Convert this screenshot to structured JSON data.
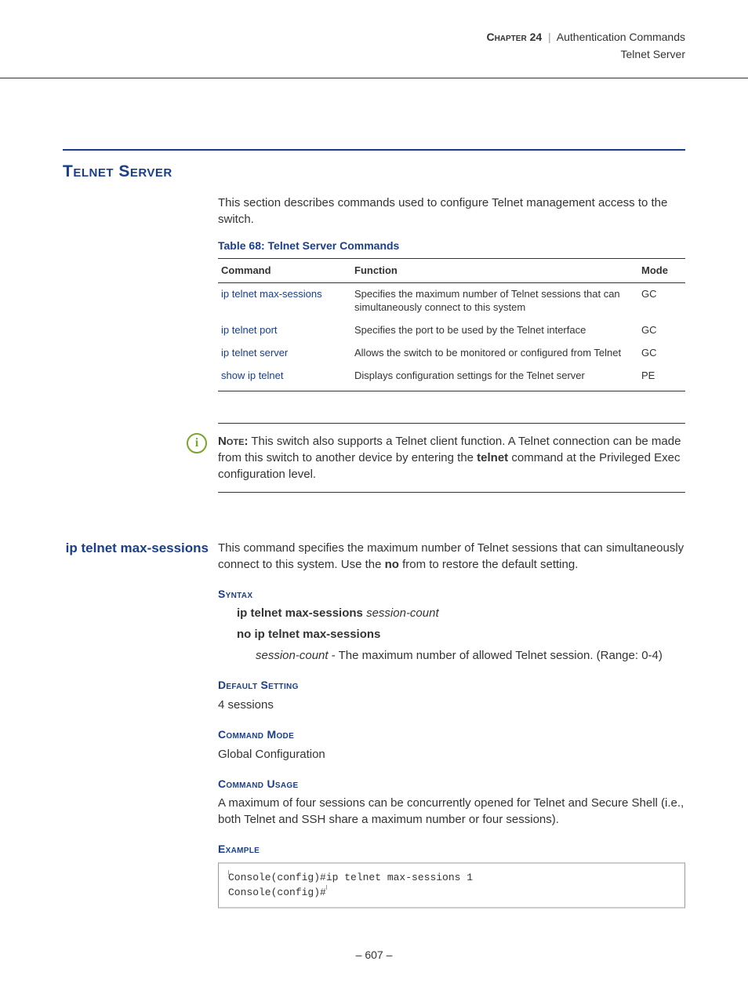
{
  "header": {
    "chapter_label": "Chapter 24",
    "separator": "|",
    "chapter_title": "Authentication Commands",
    "subsection": "Telnet Server"
  },
  "section": {
    "title": "Telnet Server",
    "intro": "This section describes commands used to configure Telnet management access to the switch."
  },
  "table": {
    "caption": "Table 68: Telnet Server Commands",
    "headers": {
      "command": "Command",
      "function": "Function",
      "mode": "Mode"
    },
    "rows": [
      {
        "command": "ip telnet max-sessions",
        "function": "Specifies the maximum number of Telnet sessions that can simultaneously connect to this system",
        "mode": "GC"
      },
      {
        "command": "ip telnet port",
        "function": "Specifies the port to be used by the Telnet interface",
        "mode": "GC"
      },
      {
        "command": "ip telnet server",
        "function": "Allows the switch to be monitored or configured from Telnet",
        "mode": "GC"
      },
      {
        "command": "show ip telnet",
        "function": "Displays configuration settings for the Telnet server",
        "mode": "PE"
      }
    ]
  },
  "note": {
    "label": "Note:",
    "text_before_bold": " This switch also supports a Telnet client function. A Telnet connection can be made from this switch to another device by entering the ",
    "bold_word": "telnet",
    "text_after_bold": " command at the Privileged Exec configuration level."
  },
  "command_detail": {
    "name": "ip telnet max-sessions",
    "description_before": "This command specifies the maximum number of Telnet sessions that can simultaneously connect to this system. Use the ",
    "description_bold": "no",
    "description_after": " from to restore the default setting.",
    "syntax_heading": "Syntax",
    "syntax_line1_kw": "ip telnet max-sessions",
    "syntax_line1_arg": "session-count",
    "syntax_line2_kw": "no ip telnet max-sessions",
    "param_arg": "session-count",
    "param_text": " - The maximum number of allowed Telnet session. (Range: 0-4)",
    "default_heading": "Default Setting",
    "default_value": "4 sessions",
    "mode_heading": "Command Mode",
    "mode_value": "Global Configuration",
    "usage_heading": "Command Usage",
    "usage_text": "A maximum of four sessions can be concurrently opened for Telnet and Secure Shell (i.e., both Telnet and SSH share a maximum number or four sessions).",
    "example_heading": "Example",
    "example_code": "Console(config)#ip telnet max-sessions 1\nConsole(config)#"
  },
  "footer": {
    "page": "–  607  –"
  }
}
